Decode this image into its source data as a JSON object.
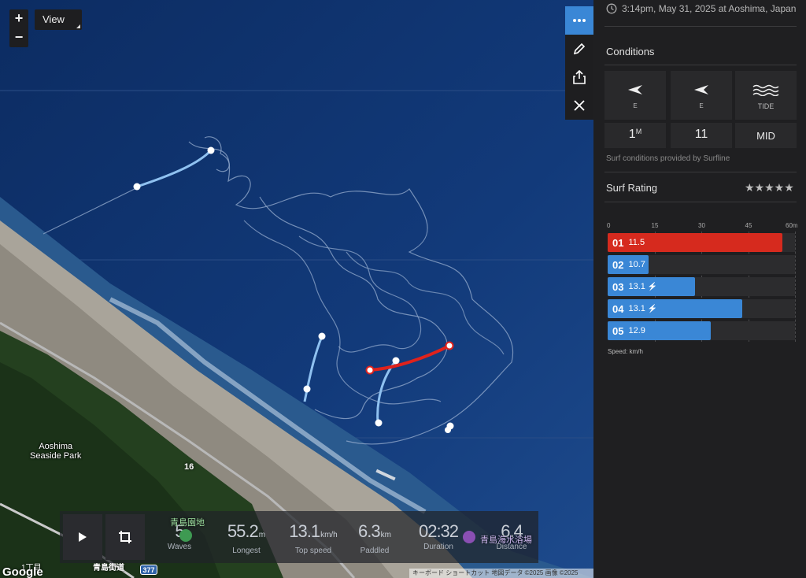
{
  "map": {
    "zoom_in": "+",
    "zoom_out": "−",
    "view_label": "View",
    "park_label_1": "Aoshima",
    "park_label_2": "Seaside Park",
    "road_16": "16",
    "road_377": "377",
    "chome": "1丁目",
    "google": "Google",
    "poi_garden": "青島園地",
    "poi_beach": "青島海水浴場",
    "road_jp": "青島街道",
    "attribution": "キーボード ショートカット  地図データ ©2025 画像 ©2025 Airbus"
  },
  "stats": {
    "waves_val": "5",
    "waves_lbl": "Waves",
    "longest_val": "55.2",
    "longest_unit": "m",
    "longest_lbl": "Longest",
    "top_val": "13.1",
    "top_unit": "km/h",
    "top_lbl": "Top speed",
    "paddled_val": "6.3",
    "paddled_unit": "km",
    "paddled_lbl": "Paddled",
    "duration_val": "02:32",
    "duration_lbl": "Duration",
    "distance_val": "6.4",
    "distance_lbl": "Distance"
  },
  "sidebar": {
    "datetime": "3:14pm, May 31, 2025 at Aoshima, Japan",
    "conditions_title": "Conditions",
    "swell_dir": "E",
    "swell_val": "1",
    "swell_unit": "M",
    "wind_dir": "E",
    "wind_val": "11",
    "tide_label": "TIDE",
    "tide_val": "MID",
    "provided": "Surf conditions provided by Surfline",
    "rating_title": "Surf Rating",
    "stars": "★★★★★",
    "speed_unit": "Speed: km/h"
  },
  "chart_data": {
    "type": "bar",
    "orientation": "horizontal",
    "x_ticks": [
      "0",
      "15",
      "30",
      "45",
      "60m"
    ],
    "xlim": [
      0,
      60
    ],
    "categories": [
      "01",
      "02",
      "03",
      "04",
      "05"
    ],
    "values": [
      56,
      13,
      28,
      43,
      33
    ],
    "speeds": [
      "11.5",
      "10.7",
      "13.1",
      "13.1",
      "12.9"
    ],
    "top_speed_flags": [
      false,
      false,
      true,
      true,
      false
    ],
    "colors": [
      "#d62a1e",
      "#3a87d6",
      "#3a87d6",
      "#3a87d6",
      "#3a87d6"
    ],
    "unit_note": "Speed: km/h"
  }
}
